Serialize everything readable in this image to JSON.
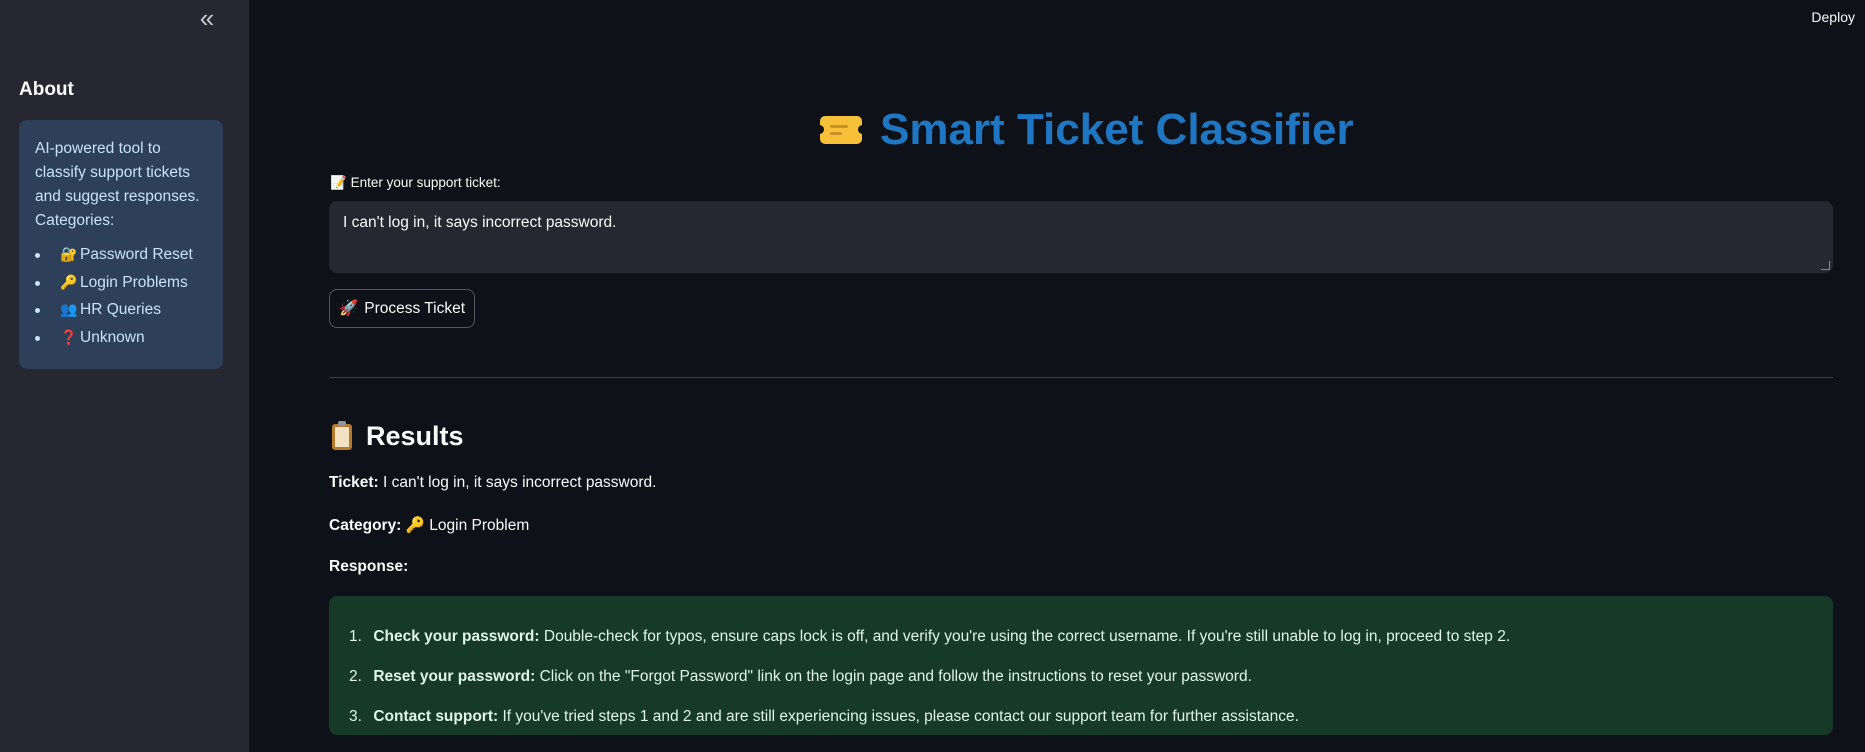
{
  "sidebar": {
    "collapse_icon": "«",
    "about_title": "About",
    "info_text": "AI-powered tool to classify support tickets and suggest responses. Categories:",
    "categories": [
      {
        "icon": "🔐",
        "label": "Password Reset"
      },
      {
        "icon": "🔑",
        "label": "Login Problems"
      },
      {
        "icon": "👥",
        "label": "HR Queries"
      },
      {
        "icon": "❓",
        "label": "Unknown"
      }
    ]
  },
  "header": {
    "deploy_label": "Deploy"
  },
  "main": {
    "title": "Smart Ticket Classifier",
    "title_icon": "ticket-icon",
    "input_label_icon": "📝",
    "input_label": "Enter your support ticket:",
    "ticket_value": "I can't log in, it says incorrect password.",
    "process_button_icon": "🚀",
    "process_button_label": "Process Ticket"
  },
  "results": {
    "title_icon": "clipboard-icon",
    "title": "Results",
    "ticket_label": "Ticket:",
    "ticket_value": "I can't log in, it says incorrect password.",
    "category_label": "Category:",
    "category_icon": "🔑",
    "category_value": "Login Problem",
    "response_label": "Response:",
    "steps": [
      {
        "num": "1.",
        "bold": "Check your password:",
        "text": "Double-check for typos, ensure caps lock is off, and verify you're using the correct username. If you're still unable to log in, proceed to step 2."
      },
      {
        "num": "2.",
        "bold": "Reset your password:",
        "text": "Click on the \"Forgot Password\" link on the login page and follow the instructions to reset your password."
      },
      {
        "num": "3.",
        "bold": "Contact support:",
        "text": "If you've tried steps 1 and 2 and are still experiencing issues, please contact our support team for further assistance."
      }
    ]
  },
  "colors": {
    "background": "#0e1117",
    "sidebar": "#262730",
    "title": "#1f77c4",
    "info_box": "#2d3f59",
    "success_box": "#173928"
  }
}
